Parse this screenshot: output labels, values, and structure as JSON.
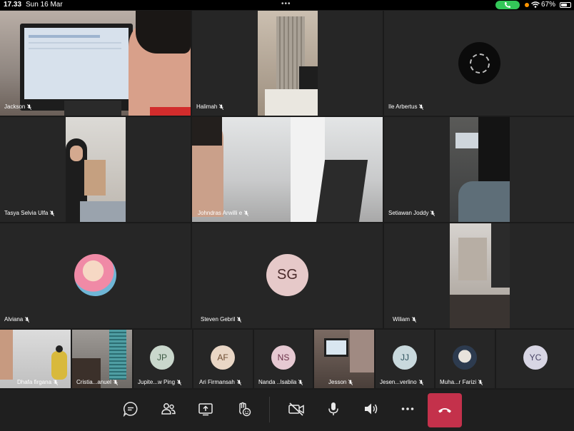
{
  "status": {
    "time": "17.33",
    "date": "Sun 16 Mar",
    "battery": "67%",
    "battery_level": 0.67
  },
  "participants": {
    "jackson": "Jackson",
    "halimah": "Halimah",
    "ile": "Ile Arbertus",
    "tasya": "Tasya Selvia Ulfa",
    "johndras": "Johndras Arwilli e",
    "setiawan": "Setiawan Joddy",
    "alviana": "Alviana",
    "steven": "Steven Gebril",
    "steven_initials": "SG",
    "wiliam": "Wiliam",
    "dhafa": "Dhafa firgana",
    "cristia": "Cristia...anuel",
    "jupite": "Jupite...w Ping",
    "jupite_initials": "JP",
    "ari": "Ari Firmansah",
    "ari_initials": "AF",
    "nanda": "Nanda ..Isabila",
    "nanda_initials": "NS",
    "jesson": "Jesson",
    "jesen": "Jesen...verlino",
    "jesen_initials": "JJ",
    "muha": "Muha...r Farizi",
    "yc_initials": "YC"
  },
  "toolbar": {
    "items": [
      "chat-icon",
      "people-icon",
      "share-screen-icon",
      "raise-hand-icon",
      "camera-off-icon",
      "mic-icon",
      "speaker-icon",
      "more-icon",
      "hang-up-icon"
    ]
  },
  "colors": {
    "tile_bg": "#262626",
    "avatar_jp": "#c9d7cc",
    "avatar_af": "#e9d6c5",
    "avatar_ns": "#e6c9d2",
    "avatar_jj": "#c9d9dd",
    "avatar_yc": "#d8d6e4",
    "avatar_sg": "#e6c9c9",
    "hangup": "#c4314b",
    "call_pill": "#34c759"
  }
}
